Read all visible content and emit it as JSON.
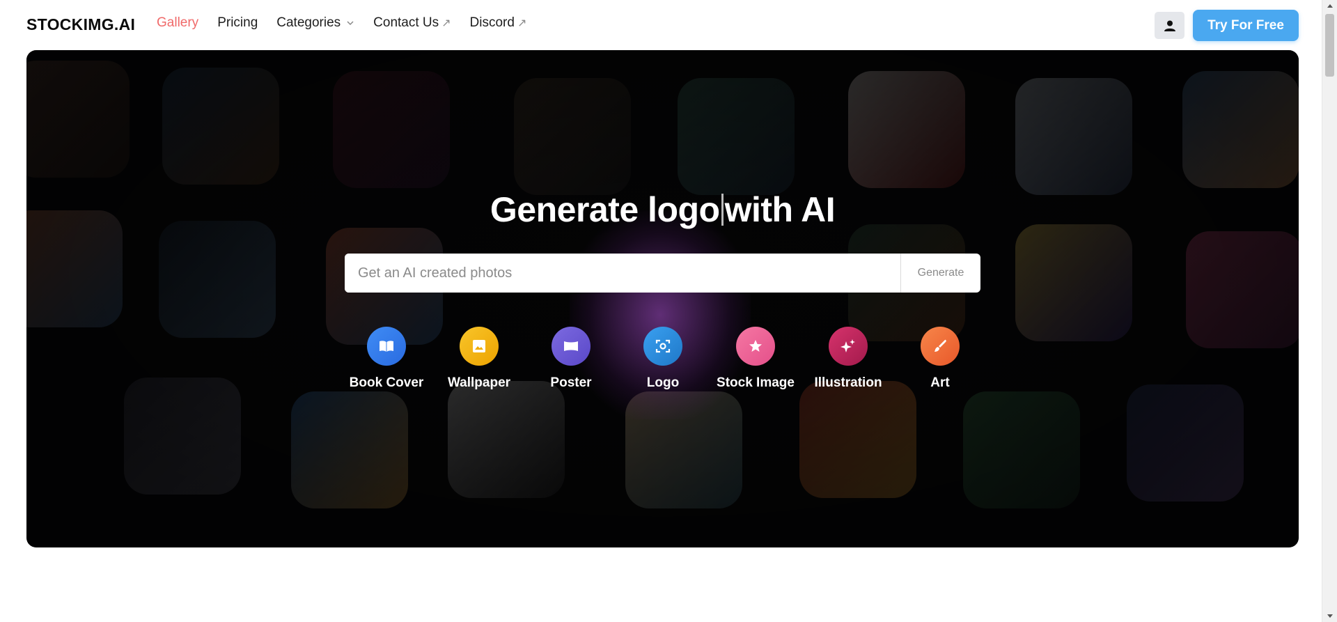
{
  "brand": {
    "logo_text": "STOCKIMG.AI"
  },
  "nav": {
    "items": [
      {
        "label": "Gallery",
        "active": true
      },
      {
        "label": "Pricing"
      },
      {
        "label": "Categories",
        "icon": "chevron-down-icon"
      },
      {
        "label": "Contact Us",
        "icon": "external-link-icon"
      },
      {
        "label": "Discord",
        "icon": "external-link-icon"
      }
    ],
    "external_glyph": "↗"
  },
  "header": {
    "user_icon": "user-icon",
    "cta_label": "Try For Free"
  },
  "hero": {
    "title_before": "Generate logo",
    "title_after": "with AI",
    "search": {
      "placeholder": "Get an AI created photos",
      "value": ""
    },
    "generate_label": "Generate",
    "categories": [
      {
        "label": "Book Cover",
        "icon": "book-icon",
        "color": "#3b82f6"
      },
      {
        "label": "Wallpaper",
        "icon": "image-icon",
        "color": "#f5b400"
      },
      {
        "label": "Poster",
        "icon": "poster-icon",
        "color": "#6b5bd6"
      },
      {
        "label": "Logo",
        "icon": "focus-icon",
        "color": "#2b8fe0"
      },
      {
        "label": "Stock Image",
        "icon": "star-icon",
        "color": "#f06292"
      },
      {
        "label": "Illustration",
        "icon": "sparkles-icon",
        "color": "#c0245c"
      },
      {
        "label": "Art",
        "icon": "brush-icon",
        "color": "#f26b3a"
      }
    ]
  },
  "colors": {
    "accent": "#4aa8f0",
    "active_nav": "#f06a6a",
    "hero_bg": "#050506"
  }
}
